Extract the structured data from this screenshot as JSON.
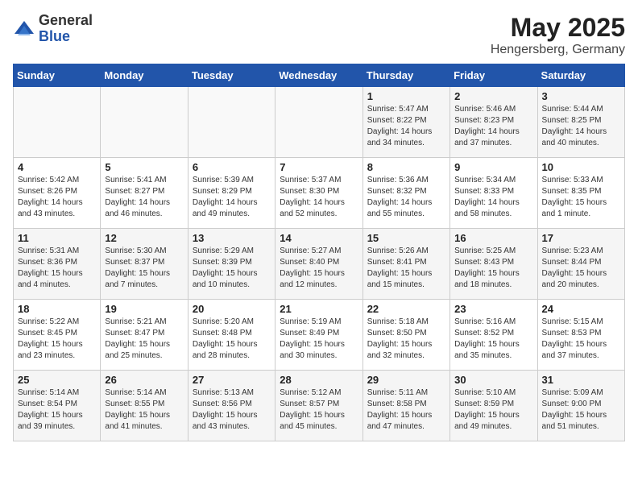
{
  "header": {
    "logo_general": "General",
    "logo_blue": "Blue",
    "title": "May 2025",
    "subtitle": "Hengersberg, Germany"
  },
  "weekdays": [
    "Sunday",
    "Monday",
    "Tuesday",
    "Wednesday",
    "Thursday",
    "Friday",
    "Saturday"
  ],
  "weeks": [
    [
      {
        "day": "",
        "info": ""
      },
      {
        "day": "",
        "info": ""
      },
      {
        "day": "",
        "info": ""
      },
      {
        "day": "",
        "info": ""
      },
      {
        "day": "1",
        "info": "Sunrise: 5:47 AM\nSunset: 8:22 PM\nDaylight: 14 hours\nand 34 minutes."
      },
      {
        "day": "2",
        "info": "Sunrise: 5:46 AM\nSunset: 8:23 PM\nDaylight: 14 hours\nand 37 minutes."
      },
      {
        "day": "3",
        "info": "Sunrise: 5:44 AM\nSunset: 8:25 PM\nDaylight: 14 hours\nand 40 minutes."
      }
    ],
    [
      {
        "day": "4",
        "info": "Sunrise: 5:42 AM\nSunset: 8:26 PM\nDaylight: 14 hours\nand 43 minutes."
      },
      {
        "day": "5",
        "info": "Sunrise: 5:41 AM\nSunset: 8:27 PM\nDaylight: 14 hours\nand 46 minutes."
      },
      {
        "day": "6",
        "info": "Sunrise: 5:39 AM\nSunset: 8:29 PM\nDaylight: 14 hours\nand 49 minutes."
      },
      {
        "day": "7",
        "info": "Sunrise: 5:37 AM\nSunset: 8:30 PM\nDaylight: 14 hours\nand 52 minutes."
      },
      {
        "day": "8",
        "info": "Sunrise: 5:36 AM\nSunset: 8:32 PM\nDaylight: 14 hours\nand 55 minutes."
      },
      {
        "day": "9",
        "info": "Sunrise: 5:34 AM\nSunset: 8:33 PM\nDaylight: 14 hours\nand 58 minutes."
      },
      {
        "day": "10",
        "info": "Sunrise: 5:33 AM\nSunset: 8:35 PM\nDaylight: 15 hours\nand 1 minute."
      }
    ],
    [
      {
        "day": "11",
        "info": "Sunrise: 5:31 AM\nSunset: 8:36 PM\nDaylight: 15 hours\nand 4 minutes."
      },
      {
        "day": "12",
        "info": "Sunrise: 5:30 AM\nSunset: 8:37 PM\nDaylight: 15 hours\nand 7 minutes."
      },
      {
        "day": "13",
        "info": "Sunrise: 5:29 AM\nSunset: 8:39 PM\nDaylight: 15 hours\nand 10 minutes."
      },
      {
        "day": "14",
        "info": "Sunrise: 5:27 AM\nSunset: 8:40 PM\nDaylight: 15 hours\nand 12 minutes."
      },
      {
        "day": "15",
        "info": "Sunrise: 5:26 AM\nSunset: 8:41 PM\nDaylight: 15 hours\nand 15 minutes."
      },
      {
        "day": "16",
        "info": "Sunrise: 5:25 AM\nSunset: 8:43 PM\nDaylight: 15 hours\nand 18 minutes."
      },
      {
        "day": "17",
        "info": "Sunrise: 5:23 AM\nSunset: 8:44 PM\nDaylight: 15 hours\nand 20 minutes."
      }
    ],
    [
      {
        "day": "18",
        "info": "Sunrise: 5:22 AM\nSunset: 8:45 PM\nDaylight: 15 hours\nand 23 minutes."
      },
      {
        "day": "19",
        "info": "Sunrise: 5:21 AM\nSunset: 8:47 PM\nDaylight: 15 hours\nand 25 minutes."
      },
      {
        "day": "20",
        "info": "Sunrise: 5:20 AM\nSunset: 8:48 PM\nDaylight: 15 hours\nand 28 minutes."
      },
      {
        "day": "21",
        "info": "Sunrise: 5:19 AM\nSunset: 8:49 PM\nDaylight: 15 hours\nand 30 minutes."
      },
      {
        "day": "22",
        "info": "Sunrise: 5:18 AM\nSunset: 8:50 PM\nDaylight: 15 hours\nand 32 minutes."
      },
      {
        "day": "23",
        "info": "Sunrise: 5:16 AM\nSunset: 8:52 PM\nDaylight: 15 hours\nand 35 minutes."
      },
      {
        "day": "24",
        "info": "Sunrise: 5:15 AM\nSunset: 8:53 PM\nDaylight: 15 hours\nand 37 minutes."
      }
    ],
    [
      {
        "day": "25",
        "info": "Sunrise: 5:14 AM\nSunset: 8:54 PM\nDaylight: 15 hours\nand 39 minutes."
      },
      {
        "day": "26",
        "info": "Sunrise: 5:14 AM\nSunset: 8:55 PM\nDaylight: 15 hours\nand 41 minutes."
      },
      {
        "day": "27",
        "info": "Sunrise: 5:13 AM\nSunset: 8:56 PM\nDaylight: 15 hours\nand 43 minutes."
      },
      {
        "day": "28",
        "info": "Sunrise: 5:12 AM\nSunset: 8:57 PM\nDaylight: 15 hours\nand 45 minutes."
      },
      {
        "day": "29",
        "info": "Sunrise: 5:11 AM\nSunset: 8:58 PM\nDaylight: 15 hours\nand 47 minutes."
      },
      {
        "day": "30",
        "info": "Sunrise: 5:10 AM\nSunset: 8:59 PM\nDaylight: 15 hours\nand 49 minutes."
      },
      {
        "day": "31",
        "info": "Sunrise: 5:09 AM\nSunset: 9:00 PM\nDaylight: 15 hours\nand 51 minutes."
      }
    ]
  ]
}
